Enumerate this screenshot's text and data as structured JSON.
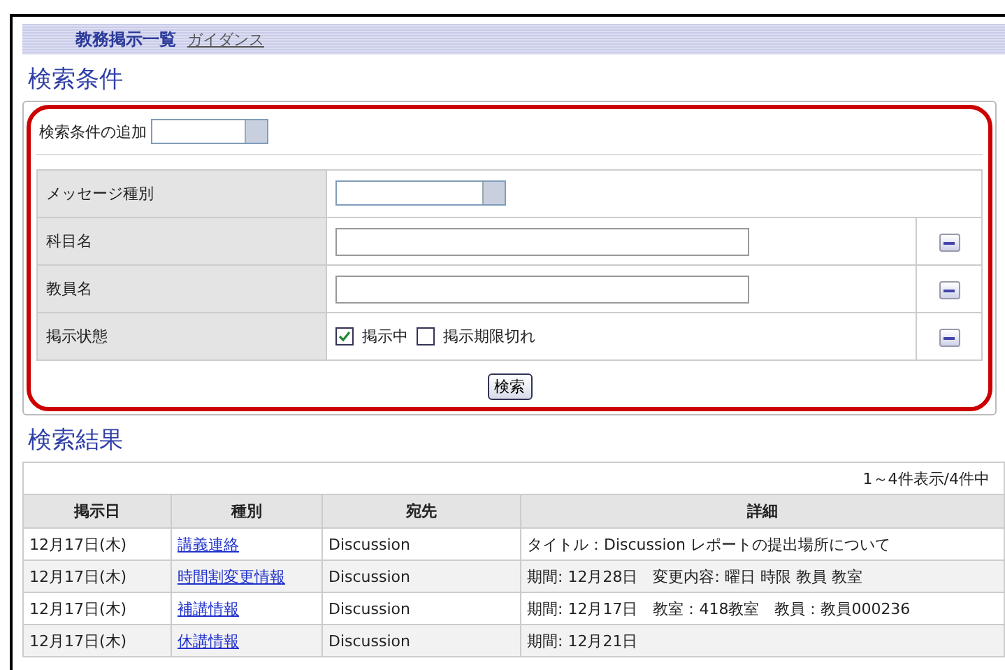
{
  "header": {
    "title": "教務掲示一覧",
    "link": "ガイダンス"
  },
  "search": {
    "heading": "検索条件",
    "add_label": "検索条件の追加",
    "conditions": [
      {
        "kind": "select",
        "label": "メッセージ種別",
        "removable": false
      },
      {
        "kind": "text",
        "label": "科目名",
        "removable": true
      },
      {
        "kind": "text",
        "label": "教員名",
        "removable": true
      },
      {
        "kind": "checks",
        "label": "掲示状態",
        "removable": true,
        "options": [
          {
            "label": "掲示中",
            "checked": true
          },
          {
            "label": "掲示期限切れ",
            "checked": false
          }
        ]
      }
    ],
    "button": "検索"
  },
  "results": {
    "heading": "検索結果",
    "count": "1～4件表示/4件中",
    "columns": [
      "掲示日",
      "種別",
      "宛先",
      "詳細"
    ],
    "rows": [
      {
        "date": "12月17日(木)",
        "type": "講義連絡",
        "to": "Discussion",
        "detail": "タイトル：Discussion レポートの提出場所について"
      },
      {
        "date": "12月17日(木)",
        "type": "時間割変更情報",
        "to": "Discussion",
        "detail": "期間: 12月28日　変更内容: 曜日 時限 教員 教室"
      },
      {
        "date": "12月17日(木)",
        "type": "補講情報",
        "to": "Discussion",
        "detail": "期間: 12月17日　教室：418教室　教員：教員000236"
      },
      {
        "date": "12月17日(木)",
        "type": "休講情報",
        "to": "Discussion",
        "detail": "期間: 12月21日"
      }
    ]
  }
}
